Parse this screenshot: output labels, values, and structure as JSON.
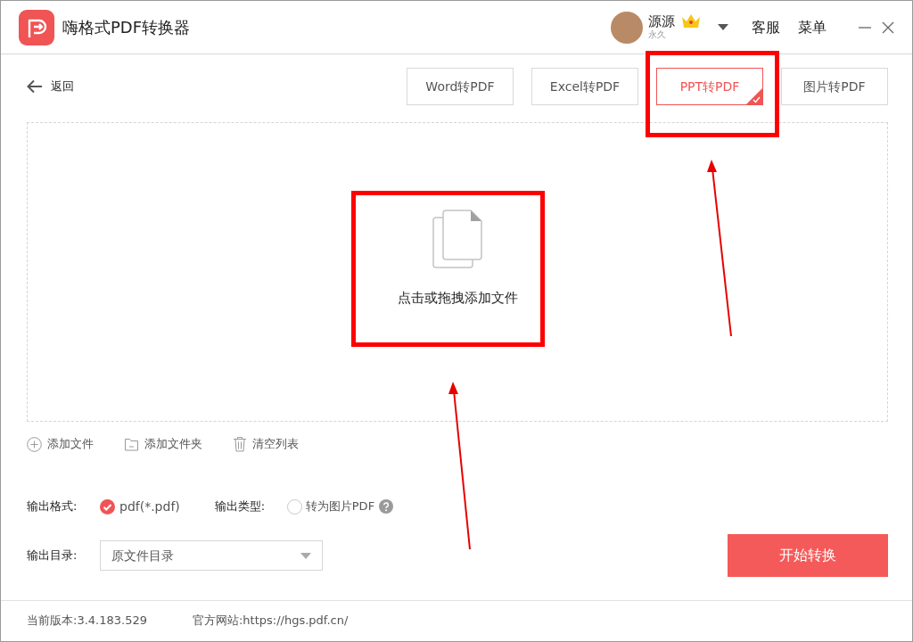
{
  "window": {
    "title": "嗨格式PDF转换器"
  },
  "user": {
    "name": "源源",
    "membership": "永久"
  },
  "header_links": [
    "客服",
    "菜单"
  ],
  "back": {
    "label": "返回"
  },
  "tabs": [
    {
      "label": "Word转PDF",
      "selected": false
    },
    {
      "label": "Excel转PDF",
      "selected": false
    },
    {
      "label": "PPT转PDF",
      "selected": true
    },
    {
      "label": "图片转PDF",
      "selected": false
    }
  ],
  "drop_zone": {
    "label": "点击或拖拽添加文件"
  },
  "toolbar": [
    {
      "kind": "add",
      "label": "添加文件"
    },
    {
      "kind": "folder",
      "label": "添加文件夹"
    },
    {
      "kind": "clear",
      "label": "清空列表"
    }
  ],
  "output_format": {
    "label": "输出格式:",
    "option": "pdf(*.pdf)",
    "checked": true
  },
  "output_type": {
    "label": "输出类型:",
    "option": "转为图片PDF",
    "checked": false
  },
  "output_dir": {
    "label": "输出目录:",
    "value": "原文件目录"
  },
  "start_button": "开始转换",
  "footer": {
    "version_label": "当前版本:",
    "version": "3.4.183.529",
    "site_label": "官方网站:",
    "site": "https://hgs.pdf.cn/"
  }
}
